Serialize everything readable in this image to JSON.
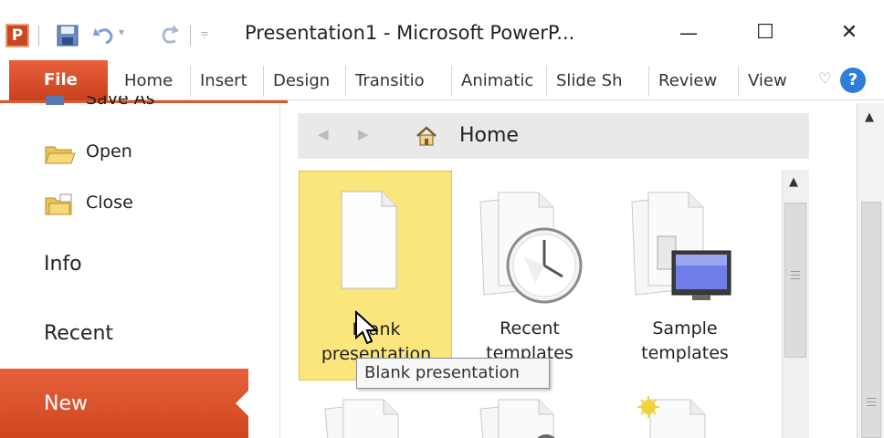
{
  "window": {
    "app_icon_letter": "P",
    "title": "Presentation1 - Microsoft PowerP...",
    "minimize_glyph": "—",
    "maximize_glyph": "☐",
    "close_glyph": "✕"
  },
  "ribbon": {
    "file_label": "File",
    "tabs": [
      "Home",
      "Insert",
      "Design",
      "Transitio",
      "Animatic",
      "Slide Sh",
      "Review",
      "View"
    ],
    "heart_glyph": "♡",
    "help_glyph": "?"
  },
  "backstage": {
    "save_as_label": "Save As",
    "open_label": "Open",
    "close_label": "Close",
    "info_label": "Info",
    "recent_label": "Recent",
    "new_label": "New"
  },
  "new_panel": {
    "breadcrumb_label": "Home",
    "tiles": [
      {
        "label_line1": "Blank",
        "label_line2": "presentation",
        "selected": true
      },
      {
        "label_line1": "Recent",
        "label_line2": "templates",
        "selected": false
      },
      {
        "label_line1": "Sample",
        "label_line2": "templates",
        "selected": false
      }
    ],
    "tooltip": "Blank presentation"
  },
  "colors": {
    "accent": "#d85a2e",
    "selected_tile": "#fbe57d",
    "help_blue": "#2e7dd8"
  }
}
